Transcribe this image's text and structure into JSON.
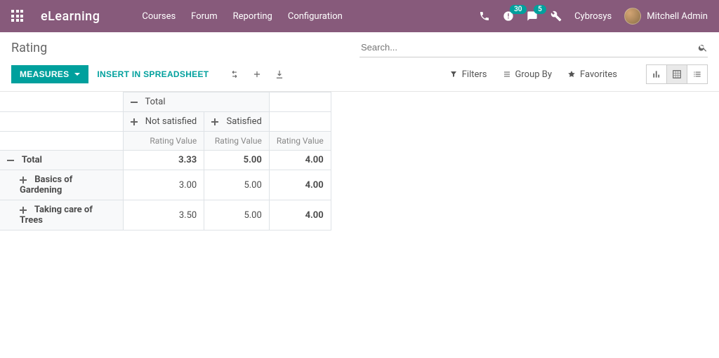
{
  "brand": "eLearning",
  "nav_menu": {
    "courses": "Courses",
    "forum": "Forum",
    "reporting": "Reporting",
    "config": "Configuration"
  },
  "navbar_right": {
    "activities_badge": "30",
    "messages_badge": "5",
    "company": "Cybrosys",
    "user": "Mitchell Admin"
  },
  "breadcrumb": "Rating",
  "search": {
    "placeholder": "Search..."
  },
  "cp": {
    "measures": "Measures",
    "insert": "Insert in Spreadsheet",
    "filters": "Filters",
    "groupby": "Group By",
    "favorites": "Favorites"
  },
  "pivot": {
    "col_total": "Total",
    "col_groups": {
      "not_satisfied": "Not satisfied",
      "satisfied": "Satisfied"
    },
    "measure_label": "Rating Value",
    "row_total": "Total",
    "rows": {
      "r1": "Basics of Gardening",
      "r2": "Taking care of Trees"
    },
    "data": {
      "total": {
        "not_satisfied": "3.33",
        "satisfied": "5.00",
        "total": "4.00"
      },
      "r1": {
        "not_satisfied": "3.00",
        "satisfied": "5.00",
        "total": "4.00"
      },
      "r2": {
        "not_satisfied": "3.50",
        "satisfied": "5.00",
        "total": "4.00"
      }
    }
  }
}
